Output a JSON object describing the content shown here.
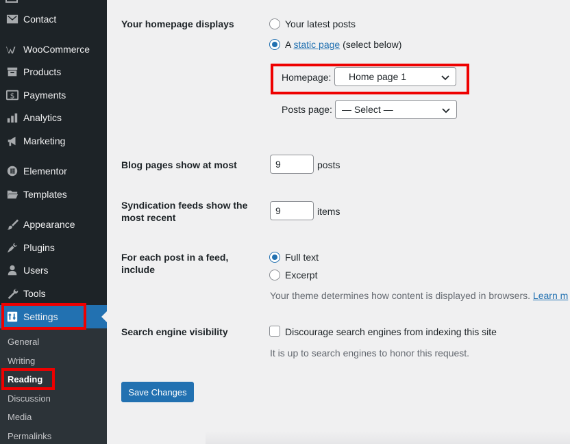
{
  "sidebar": {
    "items": [
      {
        "label": "Contact",
        "icon": "mail-icon"
      },
      {
        "label": "WooCommerce",
        "icon": "woocommerce-icon"
      },
      {
        "label": "Products",
        "icon": "archive-icon"
      },
      {
        "label": "Payments",
        "icon": "dollar-icon"
      },
      {
        "label": "Analytics",
        "icon": "bar-chart-icon"
      },
      {
        "label": "Marketing",
        "icon": "megaphone-icon"
      },
      {
        "label": "Elementor",
        "icon": "elementor-icon"
      },
      {
        "label": "Templates",
        "icon": "folder-icon"
      },
      {
        "label": "Appearance",
        "icon": "paintbrush-icon"
      },
      {
        "label": "Plugins",
        "icon": "plug-icon"
      },
      {
        "label": "Users",
        "icon": "user-icon"
      },
      {
        "label": "Tools",
        "icon": "wrench-icon"
      },
      {
        "label": "Settings",
        "icon": "settings-sliders-icon"
      }
    ],
    "submenu": [
      "General",
      "Writing",
      "Reading",
      "Discussion",
      "Media",
      "Permalinks"
    ],
    "current_item": "Settings",
    "current_sub": "Reading"
  },
  "homepage_displays": {
    "label": "Your homepage displays",
    "option_latest": "Your latest posts",
    "option_static_prefix": "A",
    "option_static_link": "static page",
    "option_static_suffix": "(select below)",
    "selected": "static",
    "homepage_label": "Homepage:",
    "homepage_value": "Home page 1",
    "posts_page_label": "Posts page:",
    "posts_page_value": "— Select —"
  },
  "blog_pages": {
    "label": "Blog pages show at most",
    "value": "9",
    "unit": "posts"
  },
  "syndication": {
    "label_line1": "Syndication feeds show the",
    "label_line2": "most recent",
    "value": "9",
    "unit": "items"
  },
  "feed_content": {
    "label_line1": "For each post in a feed,",
    "label_line2": "include",
    "option_full": "Full text",
    "option_excerpt": "Excerpt",
    "selected": "full",
    "description": "Your theme determines how content is displayed in browsers.",
    "link": "Learn m"
  },
  "search_visibility": {
    "label": "Search engine visibility",
    "checkbox_label": "Discourage search engines from indexing this site",
    "checked": false,
    "description": "It is up to search engines to honor this request."
  },
  "save_label": "Save Changes",
  "colors": {
    "accent": "#2271b1",
    "sidebar": "#1d2327",
    "highlight": "#e00000"
  }
}
